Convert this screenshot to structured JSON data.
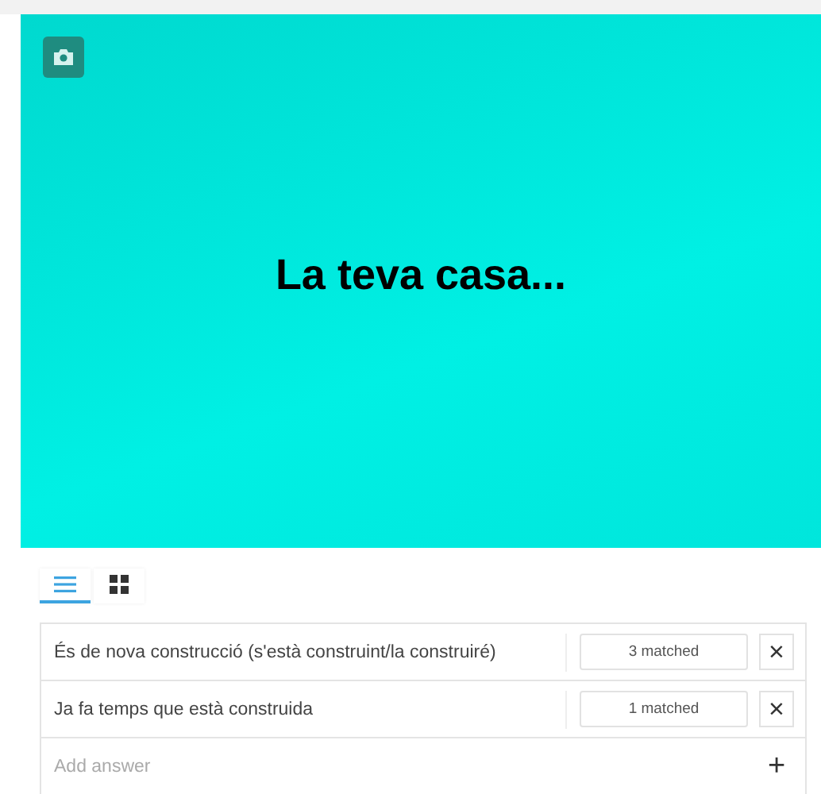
{
  "banner": {
    "title": "La teva casa..."
  },
  "view_toggle": [
    {
      "kind": "list",
      "selected": true
    },
    {
      "kind": "grid",
      "selected": false
    }
  ],
  "answers": [
    {
      "text": "És de nova construcció (s'està construint/la construiré)",
      "matched": "3 matched",
      "remove": "×"
    },
    {
      "text": "Ja fa temps que està construida",
      "matched": "1 matched",
      "remove": "×"
    }
  ],
  "add_answer": {
    "placeholder": "Add answer",
    "add": "+"
  }
}
